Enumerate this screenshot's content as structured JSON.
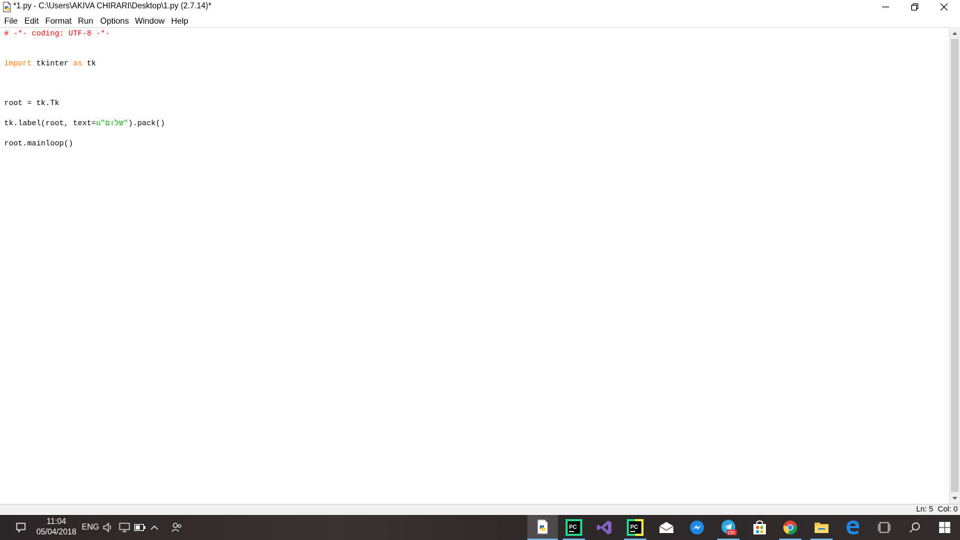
{
  "window": {
    "title": "*1.py - C:\\Users\\AKIVA CHIRARI\\Desktop\\1.py (2.7.14)*",
    "icons": {
      "app": "python-idle-file-icon",
      "minimize": "minimize-icon",
      "restore": "restore-icon",
      "close": "close-icon"
    }
  },
  "menubar": {
    "items": [
      "File",
      "Edit",
      "Format",
      "Run",
      "Options",
      "Window",
      "Help"
    ]
  },
  "editor": {
    "lines": [
      {
        "segments": [
          {
            "text": "# -*- coding: UTF-8 -*-",
            "kind": "comment"
          }
        ]
      },
      {
        "segments": [
          {
            "text": "import",
            "kind": "keyword"
          },
          {
            "text": " tkinter ",
            "kind": "plain"
          },
          {
            "text": "as",
            "kind": "keyword"
          },
          {
            "text": " tk",
            "kind": "plain"
          }
        ]
      },
      {
        "segments": [
          {
            "text": "root = tk.Tk",
            "kind": "plain"
          }
        ]
      },
      {
        "segments": [
          {
            "text": "tk.label(root, text=",
            "kind": "plain"
          },
          {
            "text": "u\"שלום\"",
            "kind": "string"
          },
          {
            "text": ").pack()",
            "kind": "plain"
          }
        ]
      },
      {
        "segments": [
          {
            "text": "root.mainloop()",
            "kind": "plain"
          }
        ]
      }
    ],
    "colors": {
      "comment": "#dd0000",
      "keyword": "#ff7700",
      "string": "#00aa00",
      "plain": "#000000"
    }
  },
  "status": {
    "line": "Ln: 5",
    "col": "Col: 0"
  },
  "taskbar": {
    "clock_time": "11:04",
    "clock_date": "05/04/2018",
    "language": "ENG",
    "tray_icons": [
      "notification-icon",
      "volume-icon",
      "network-icon",
      "battery-icon",
      "show-hidden-icons-chevron-icon",
      "people-icon"
    ],
    "apps": [
      "python-idle-icon",
      "pycharm-icon",
      "visual-studio-icon",
      "pycharm-edu-icon",
      "mail-icon",
      "messenger-icon",
      "telegram-icon",
      "store-icon",
      "chrome-icon",
      "file-explorer-icon",
      "edge-icon",
      "task-view-icon",
      "search-icon",
      "start-icon"
    ],
    "telegram_badge": "100"
  }
}
